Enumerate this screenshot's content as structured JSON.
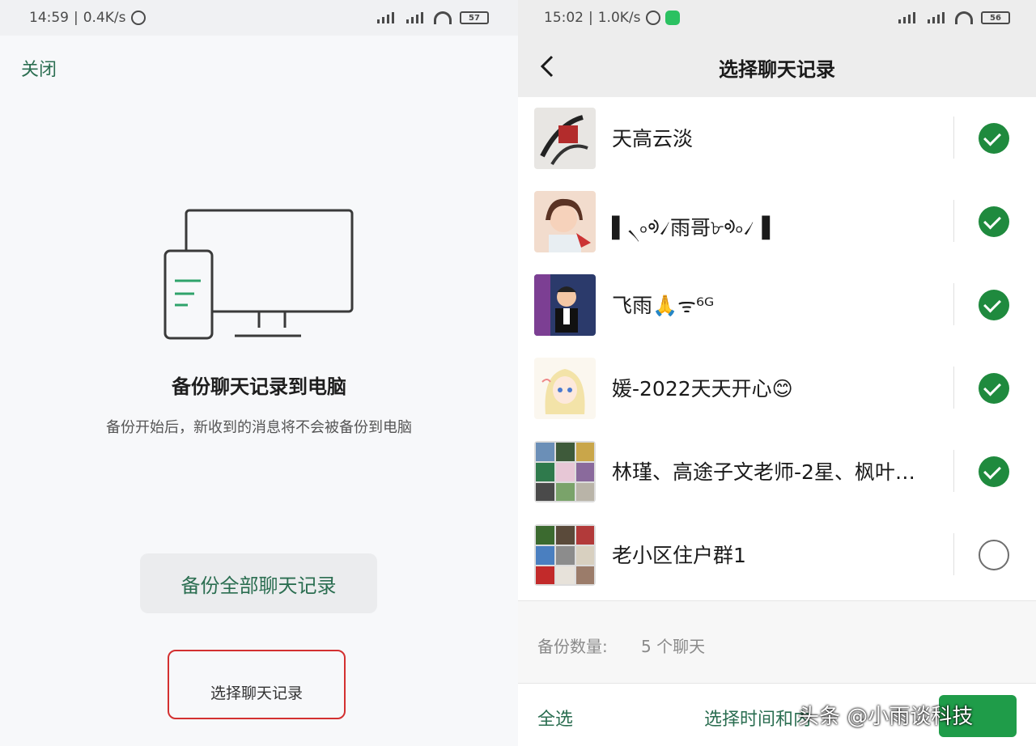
{
  "left_screen": {
    "status_bar": {
      "time": "14:59",
      "speed": "0.4K/s",
      "battery": "57"
    },
    "close_label": "关闭",
    "title": "备份聊天记录到电脑",
    "subtitle": "备份开始后，新收到的消息将不会被备份到电脑",
    "backup_all_label": "备份全部聊天记录",
    "select_records_label": "选择聊天记录",
    "highlight_color": "#d33030",
    "accent_color": "#2b6e51",
    "icons": [
      "alarm-icon",
      "signal-icon",
      "wifi-icon",
      "battery-icon",
      "phone-monitor-illustration"
    ]
  },
  "right_screen": {
    "status_bar": {
      "time": "15:02",
      "speed": "1.0K/s",
      "battery": "56"
    },
    "title": "选择聊天记录",
    "chats": [
      {
        "name": "天高云淡",
        "selected": true,
        "avatar": "calligraphy-avatar"
      },
      {
        "name": "▌৲৹ᢀ৴雨哥৮ᢀ৹৴▐",
        "selected": true,
        "avatar": "portrait-avatar"
      },
      {
        "name": "飞雨🙏ᯤ⁶ᴳ",
        "selected": true,
        "avatar": "cartoon-avatar"
      },
      {
        "name": "媛-2022天天开心😊",
        "selected": true,
        "avatar": "anime-girl-avatar"
      },
      {
        "name": "林瑾、高途子文老师-2星、枫叶…",
        "selected": true,
        "avatar": "group-grid-avatar"
      },
      {
        "name": "老小区住户群1",
        "selected": false,
        "avatar": "group-grid-avatar"
      }
    ],
    "count_label": "备份数量:",
    "count_value": "5 个聊天",
    "select_all_label": "全选",
    "time_range_label": "选择时间和内",
    "watermark": "头条 @小雨谈科技",
    "check_color": "#1f8a3e",
    "icons": [
      "back-chevron-icon",
      "check-icon"
    ]
  }
}
